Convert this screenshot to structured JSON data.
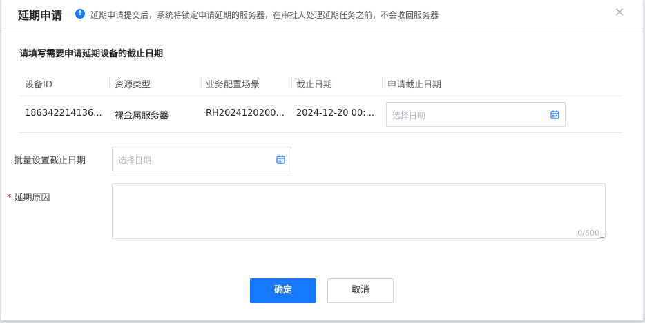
{
  "modal": {
    "title": "延期申请",
    "notice": "延期申请提交后，系统将锁定申请延期的服务器，在审批人处理延期任务之前，不会收回服务器",
    "close_icon": "close-icon"
  },
  "section_title": "请填写需要申请延期设备的截止日期",
  "table": {
    "columns": [
      "设备ID",
      "资源类型",
      "业务配置场景",
      "截止日期",
      "申请截止日期"
    ],
    "rows": [
      {
        "device_id": "186342214136...",
        "resource_type": "裸金属服务器",
        "scene": "RH2024120200...",
        "deadline": "2024-12-20 00:...",
        "apply_placeholder": "选择日期"
      }
    ]
  },
  "batch": {
    "label": "批量设置截止日期",
    "placeholder": "选择日期"
  },
  "reason": {
    "required_mark": "*",
    "label": "延期原因",
    "counter": "0/500"
  },
  "buttons": {
    "confirm": "确定",
    "cancel": "取消"
  },
  "colors": {
    "primary": "#1677ff",
    "required": "#e02d2d"
  }
}
